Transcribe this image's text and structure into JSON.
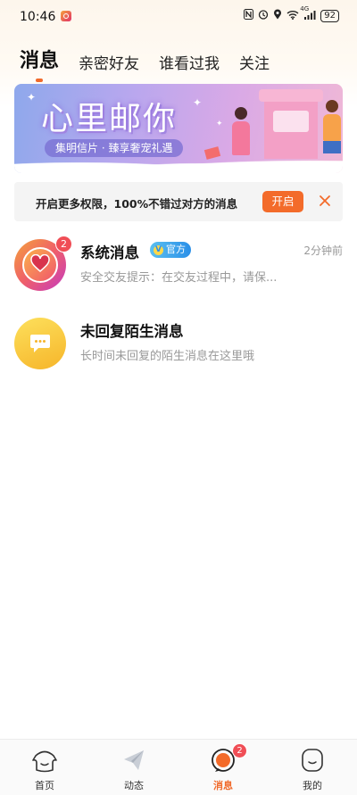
{
  "status_bar": {
    "time": "10:46",
    "battery": "92",
    "signal_label": "4G"
  },
  "tabs": [
    {
      "label": "消息",
      "active": true
    },
    {
      "label": "亲密好友",
      "active": false
    },
    {
      "label": "谁看过我",
      "active": false
    },
    {
      "label": "关注",
      "active": false
    }
  ],
  "banner": {
    "title": "心里邮你",
    "subtitle": "集明信片 · 臻享奢宠礼遇"
  },
  "permission_bar": {
    "text": "开启更多权限，100%不错过对方的消息",
    "button_label": "开启",
    "close_icon": "close-icon"
  },
  "messages": [
    {
      "title": "系统消息",
      "official_badge": "官方",
      "official_v": "V",
      "preview": "安全交友提示：在交友过程中，请保...",
      "time": "2分钟前",
      "unread": "2",
      "icon": "heart-icon"
    },
    {
      "title": "未回复陌生消息",
      "preview": "长时间未回复的陌生消息在这里哦",
      "icon": "chat-bubble-icon"
    }
  ],
  "bottom_nav": [
    {
      "label": "首页",
      "icon": "home-icon",
      "active": false
    },
    {
      "label": "动态",
      "icon": "paper-plane-icon",
      "active": false
    },
    {
      "label": "消息",
      "icon": "message-icon",
      "active": true,
      "badge": "2"
    },
    {
      "label": "我的",
      "icon": "profile-icon",
      "active": false
    }
  ],
  "colors": {
    "accent": "#f36b2a",
    "badge_red": "#f04e56",
    "official_blue": "#2a8fe8",
    "muted_text": "#999999"
  }
}
